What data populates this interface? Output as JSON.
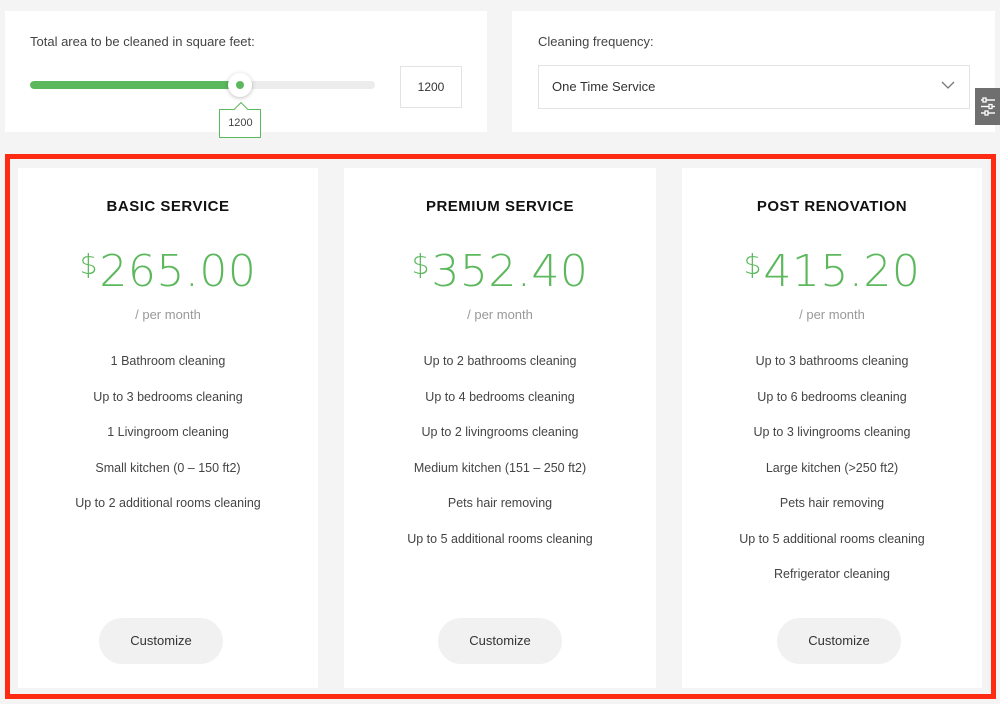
{
  "area": {
    "label": "Total area to be cleaned in square feet:",
    "value": "1200",
    "slider_fraction": 0.61,
    "accent_color": "#5cb85c"
  },
  "frequency": {
    "label": "Cleaning frequency:",
    "selected": "One Time Service",
    "chevron_icon": "chevron-down-icon"
  },
  "side_tab": {
    "icon": "sliders-icon"
  },
  "highlight_color": "#ff2a12",
  "plans": [
    {
      "title": "BASIC SERVICE",
      "currency": "$",
      "price": "265.00",
      "period": "/ per month",
      "features": [
        "1 Bathroom cleaning",
        "Up to 3 bedrooms cleaning",
        "1 Livingroom cleaning",
        "Small kitchen (0 – 150 ft2)",
        "Up to 2 additional rooms cleaning"
      ],
      "button": "Customize"
    },
    {
      "title": "PREMIUM SERVICE",
      "currency": "$",
      "price": "352.40",
      "period": "/ per month",
      "features": [
        "Up to 2 bathrooms cleaning",
        "Up to 4 bedrooms cleaning",
        "Up to 2 livingrooms cleaning",
        "Medium kitchen (151 – 250 ft2)",
        "Pets hair removing",
        "Up to 5 additional rooms cleaning"
      ],
      "button": "Customize"
    },
    {
      "title": "POST RENOVATION",
      "currency": "$",
      "price": "415.20",
      "period": "/ per month",
      "features": [
        "Up to 3 bathrooms cleaning",
        "Up to 6 bedrooms cleaning",
        "Up to 3 livingrooms cleaning",
        "Large kitchen (>250 ft2)",
        "Pets hair removing",
        "Up to 5 additional rooms cleaning",
        "Refrigerator cleaning"
      ],
      "button": "Customize"
    }
  ]
}
